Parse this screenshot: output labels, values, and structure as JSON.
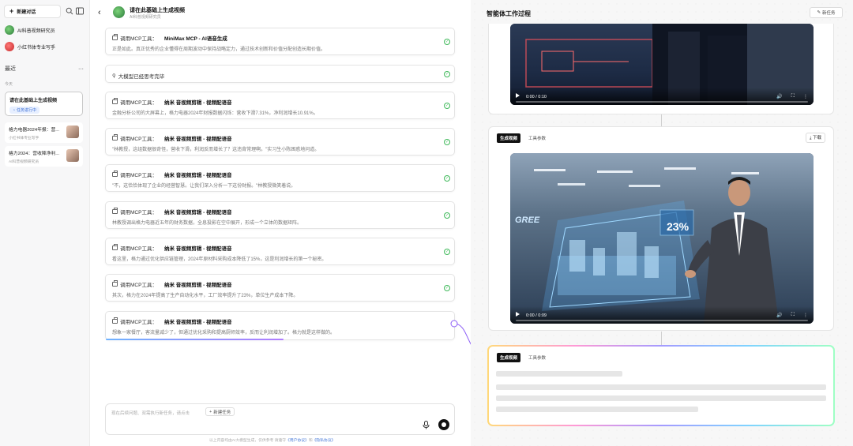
{
  "sidebar": {
    "new_chat": "新建对话",
    "agents": [
      {
        "name": "AI科普视频研究员"
      },
      {
        "name": "小红书体专业写手"
      }
    ],
    "recent_label": "最近",
    "more": "···",
    "today_label": "今天",
    "active_conv": {
      "title": "请在此基础上生成视频",
      "status": "任务进行中"
    },
    "convs": [
      {
        "title": "格力电器2024年报：营...",
        "sub": "小红书体专业写手"
      },
      {
        "title": "格力2024：营收降净利...",
        "sub": "AI科普视频研究员"
      }
    ]
  },
  "chat": {
    "title": "请在此基础上生成视频",
    "subtitle": "AI科普视频研究员",
    "cards": [
      {
        "prefix": "调用MCP工具：",
        "tool": "MiniMax MCP - AI语音生成",
        "text": "正是如此。真正优秀的企业懂得在周期波动中保持战略定力，通过技术创新和价值分配创造长期价值。"
      },
      {
        "prefix": "",
        "tool": "",
        "text": "大模型已经思考完毕"
      },
      {
        "prefix": "调用MCP工具：",
        "tool": "纳米 音视频剪辑 - 视频配语音",
        "text": "金融分析公司的大屏幕上，格力电器2024年财报数据闪烁：营收下滑7.31%，净利润增长10.91%。"
      },
      {
        "prefix": "调用MCP工具：",
        "tool": "纳米 音视频剪辑 - 视频配语音",
        "text": "\"林教授，这组数据很奇怪，营收下滑，利润反而增长了？这违背常理啊。\"实习生小陈困惑地问道。"
      },
      {
        "prefix": "调用MCP工具：",
        "tool": "纳米 音视频剪辑 - 视频配语音",
        "text": "\"不，这恰恰体现了企业的经营智慧。让我们深入分析一下这份财报。\"林教授微笑着说。"
      },
      {
        "prefix": "调用MCP工具：",
        "tool": "纳米 音视频剪辑 - 视频配语音",
        "text": "林教授调出格力电器近五年的财务数据，全息投影在空中展开，形成一个立体的数据矩阵。"
      },
      {
        "prefix": "调用MCP工具：",
        "tool": "纳米 音视频剪辑 - 视频配语音",
        "text": "看这里，格力通过优化供应链管理，2024年原材料采购成本降低了15%，这是利润增长的第一个秘密。"
      },
      {
        "prefix": "调用MCP工具：",
        "tool": "纳米 音视频剪辑 - 视频配语音",
        "text": "其次，格力在2024年提高了生产自动化水平，工厂效率提升了23%，单位生产成本下降。"
      },
      {
        "prefix": "调用MCP工具：",
        "tool": "纳米 音视频剪辑 - 视频配语音",
        "text": "想象一家餐厅，客流量减少了，但通过优化采购和提高厨师效率，反而让利润增加了。格力就是这样做的。"
      }
    ],
    "input_placeholder": "现在后续问题、双需执行新任务，请点击",
    "new_task_chip": "新建任务",
    "disclaimer_pre": "以上内容均由AI大模型生成，仅供参考   请遵守",
    "disclaimer_l1": "《用户协议》",
    "disclaimer_mid": "和",
    "disclaimer_l2": "《隐私协议》"
  },
  "panel": {
    "title": "智能体工作过程",
    "new_task": "新任务",
    "video1": {
      "time": "0:00 / 0:10",
      "progress": 0
    },
    "card2": {
      "tab_on": "生成视频",
      "tab_off": "工具参数",
      "download": "下载"
    },
    "video2": {
      "time": "0:00 / 0:09",
      "progress": 0,
      "overlay": "23%",
      "brand": "GREE"
    },
    "card3": {
      "tab_on": "生成视频",
      "tab_off": "工具参数"
    }
  },
  "colors": {
    "accent": "#4a7bd8",
    "success": "#3fb95a",
    "dark": "#111111"
  }
}
